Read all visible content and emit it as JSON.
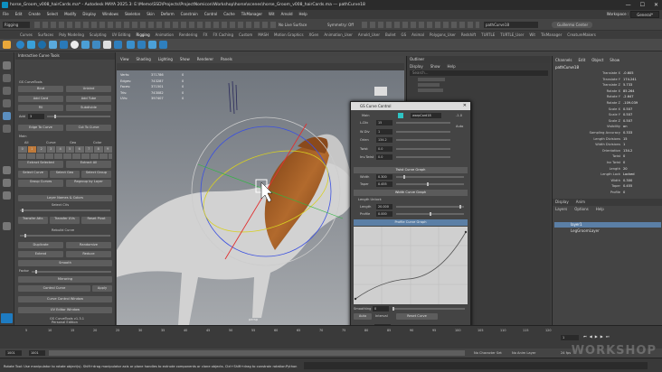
{
  "window": {
    "title": "horse_Groom_v008_hairCards.ma* - Autodesk MAYA 2025.3: E:\\Memo\\SSD\\Projects\\ProjectNomicon\\Workshop\\horse\\scenes\\horse_Groom_v008_hairCards.ma --- pathCurve18",
    "controls": [
      "—",
      "☐",
      "✕"
    ]
  },
  "menubar": [
    "File",
    "Edit",
    "Create",
    "Select",
    "Modify",
    "Display",
    "Windows",
    "Skeleton",
    "Skin",
    "Deform",
    "Constrain",
    "Control",
    "Cache",
    "TikManager",
    "Wit",
    "Arnold",
    "Help"
  ],
  "workspace": {
    "label": "Workspace :",
    "value": "General*"
  },
  "statusline": {
    "mode": "Rigging",
    "live_surface": "No Live Surface",
    "symmetry": "Symmetry: Off",
    "object_field": "pathCurve18",
    "user": "Guillermo Center"
  },
  "shelf_tabs": [
    "Curves",
    "Surfaces",
    "Poly Modeling",
    "Sculpting",
    "UV Editing",
    "Rigging",
    "Animation",
    "Rendering",
    "FX",
    "FX Caching",
    "Custom",
    "MASH",
    "Motion Graphics",
    "XGen",
    "Animation_User",
    "Arnold_User",
    "Bullet",
    "GS",
    "Animal",
    "Polygons_User",
    "Redshift",
    "TURTLE",
    "TURTLE_User",
    "Wit",
    "TikManager",
    "CreatureMakers"
  ],
  "shelf_selected": "Rigging",
  "left_panel": {
    "header": "Interactive Curve Tools",
    "title": "GS CurveTools",
    "buttons_row1": [
      "Bind",
      "Unbind"
    ],
    "buttons_row2": [
      "Add Card",
      "Add Tube"
    ],
    "buttons_row3": [
      "Fill",
      "Subdivide"
    ],
    "add_label": "Add",
    "add_value": "3",
    "buttons_row4": [
      "Edge To Curve",
      "Cut To Curve"
    ],
    "main_label": "Main",
    "layer_headers": [
      "All",
      "Curve",
      "Geo",
      "Color"
    ],
    "layer_numbers": [
      "0",
      "1",
      "2",
      "3",
      "4",
      "5",
      "6",
      "7",
      "8",
      "9"
    ],
    "extract": [
      "Extract Selected",
      "Extract All"
    ],
    "group": [
      "Select Curve",
      "Select Geo",
      "Select Group"
    ],
    "group2": [
      "Group Curves",
      "Regroup by Layer"
    ],
    "layer_names": "Layer Names & Colors",
    "select_cvs": "Select CVs",
    "transfer": [
      "Transfer Attr.",
      "Transfer UVs",
      "Reset Pivot"
    ],
    "rebuild": "Rebuild Curve",
    "duplicate": [
      "Duplicate",
      "Randomize"
    ],
    "extend": [
      "Extend",
      "Reduce"
    ],
    "smooth": "Smooth",
    "factor": "Factor",
    "mirroring": "Mirroring",
    "control_curve": "Control Curve",
    "apply": "Apply",
    "control_window": "Curve Control Window",
    "uv_editor": "UV Editor Window",
    "version": "GS CurveTools v1.3.1",
    "edition": "Personal Edition"
  },
  "viewport": {
    "menu": [
      "View",
      "Shading",
      "Lighting",
      "Show",
      "Renderer",
      "Panels"
    ],
    "hud_labels": [
      "Verts:",
      "Edges:",
      "Faces:",
      "Tris:",
      "UVs:"
    ],
    "hud_values": [
      "371786",
      "743287",
      "371501",
      "743082",
      "397407"
    ],
    "hud_zero": "0",
    "camera": "persp"
  },
  "outliner": {
    "title": "Outliner",
    "menu": [
      "Display",
      "Show",
      "Help"
    ],
    "search_placeholder": "Search..."
  },
  "channel_box": {
    "menu": [
      "Channels",
      "Edit",
      "Object",
      "Show"
    ],
    "object": "pathCurve18",
    "channels": [
      {
        "name": "Translate X",
        "value": "-0.605"
      },
      {
        "name": "Translate Y",
        "value": "174.241"
      },
      {
        "name": "Translate Z",
        "value": "5.733"
      },
      {
        "name": "Rotate X",
        "value": "85.264"
      },
      {
        "name": "Rotate Y",
        "value": "-2.647"
      },
      {
        "name": "Rotate Z",
        "value": "-109.039"
      },
      {
        "name": "Scale X",
        "value": "0.507"
      },
      {
        "name": "Scale Y",
        "value": "0.507"
      },
      {
        "name": "Scale Z",
        "value": "0.507"
      },
      {
        "name": "Visibility",
        "value": "on"
      },
      {
        "name": "Sampling Accuracy",
        "value": "0.333"
      },
      {
        "name": "Length Divisions",
        "value": "15"
      },
      {
        "name": "Width Divisions",
        "value": "1"
      },
      {
        "name": "Orientation",
        "value": "134.2"
      },
      {
        "name": "Twist",
        "value": "0"
      },
      {
        "name": "Inv Twist",
        "value": "0"
      },
      {
        "name": "Length",
        "value": "20"
      },
      {
        "name": "Length Lock",
        "value": "Locked"
      },
      {
        "name": "Width",
        "value": "0.300"
      },
      {
        "name": "Taper",
        "value": "0.455"
      },
      {
        "name": "Profile",
        "value": "0"
      }
    ],
    "display_tabs": [
      "Display",
      "Anim"
    ],
    "layer_menu": [
      "Layers",
      "Options",
      "Help"
    ],
    "layers": [
      "layer1",
      "LegGroomLayer"
    ]
  },
  "dialog": {
    "title": "GS Curve Control",
    "main": "Main",
    "curve_name": "warpCard18",
    "curve_value": "-1.0",
    "auto": "Auto",
    "rows": [
      {
        "label": "L-Div",
        "value": "15"
      },
      {
        "label": "W-Div",
        "value": "1"
      },
      {
        "label": "Orien",
        "value": "134.2"
      },
      {
        "label": "Twist",
        "value": "0.0"
      },
      {
        "label": "Inv.Twist",
        "value": "0.0"
      }
    ],
    "twist_graph": "Twist Curve Graph",
    "width_label": "Width",
    "width_value": "0.300",
    "taper_label": "Taper",
    "taper_value": "0.455",
    "width_graph": "Width Curve Graph",
    "length_unlock": "Length Unlock",
    "length_label": "Length",
    "length_value": "20.000",
    "profile_label": "Profile",
    "profile_value": "0.000",
    "profile_graph": "Profile Curve Graph",
    "smoothing_label": "Smoothing",
    "smoothing_value": "0",
    "auto_btn": "Auto",
    "interval_label": "Interval",
    "reset_curve": "Reset Curve",
    "normals_label": "Normals",
    "normals_value": "180.0",
    "reverse_normals": "Reverse Normals",
    "options": [
      "Orient to Normals",
      "Solidify Controls",
      "Advanced Visibility",
      "UV Controls",
      "Legacy Attributes"
    ]
  },
  "timeline": {
    "ticks": [
      "5",
      "10",
      "15",
      "20",
      "25",
      "30",
      "35",
      "40",
      "45",
      "50",
      "55",
      "60",
      "65",
      "70",
      "75",
      "80",
      "85",
      "90",
      "95",
      "100",
      "105",
      "110",
      "115",
      "120"
    ],
    "current_frame": "1",
    "start": "1001",
    "range_start": "1001",
    "range_end": "120",
    "end": "1125",
    "fps": "24 fps",
    "char_set": "No Character Set",
    "anim_layer": "No Anim Layer"
  },
  "cmdline": {
    "help": "Rotate Tool: Use manipulator to rotate object(s). Shift+drag manipulator axis or plane handles to extrude components or clone objects. Ctrl+Shift+drag to constrain rotation",
    "language": "Python"
  },
  "watermark": "WORKSHOP",
  "colors": {
    "accent": "#2a8fd0",
    "selected": "#5b7fa6",
    "hair": "#9a5a26",
    "horse": "#d4d4d4"
  }
}
